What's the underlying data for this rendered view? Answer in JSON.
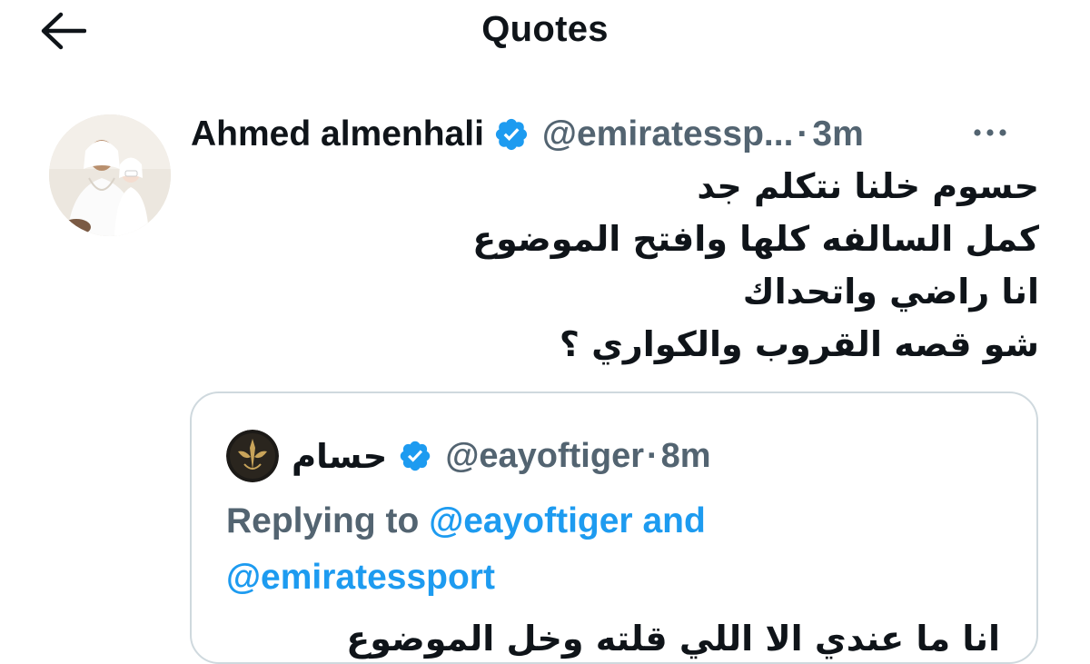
{
  "header": {
    "title": "Quotes",
    "back_icon": "arrow-left-icon"
  },
  "tweet": {
    "author_name": "Ahmed almenhali",
    "verified_icon": "verified-badge-icon",
    "handle": "@emiratessp...",
    "separator": "·",
    "time": "3m",
    "more_icon": "more-horizontal-icon",
    "body_lines": [
      "حسوم خلنا نتكلم جد",
      "كمل السالفه كلها وافتح الموضوع",
      "انا راضي واتحداك",
      "شو قصه القروب والكواري ؟"
    ]
  },
  "quote": {
    "author_name": "حسام",
    "verified_icon": "verified-badge-icon",
    "handle": "@eayoftiger",
    "separator": "·",
    "time": "8m",
    "replying_prefix": "Replying to",
    "reply_mention_1": "@eayoftiger",
    "reply_conjunction": "and",
    "reply_mention_2": "@emiratessport",
    "text_partial": "انا ما عندي الا اللي قلته وخل الموضوع"
  },
  "colors": {
    "text_primary": "#0f1419",
    "text_secondary": "#536471",
    "accent": "#1d9bf0",
    "border": "#cfd9de"
  }
}
